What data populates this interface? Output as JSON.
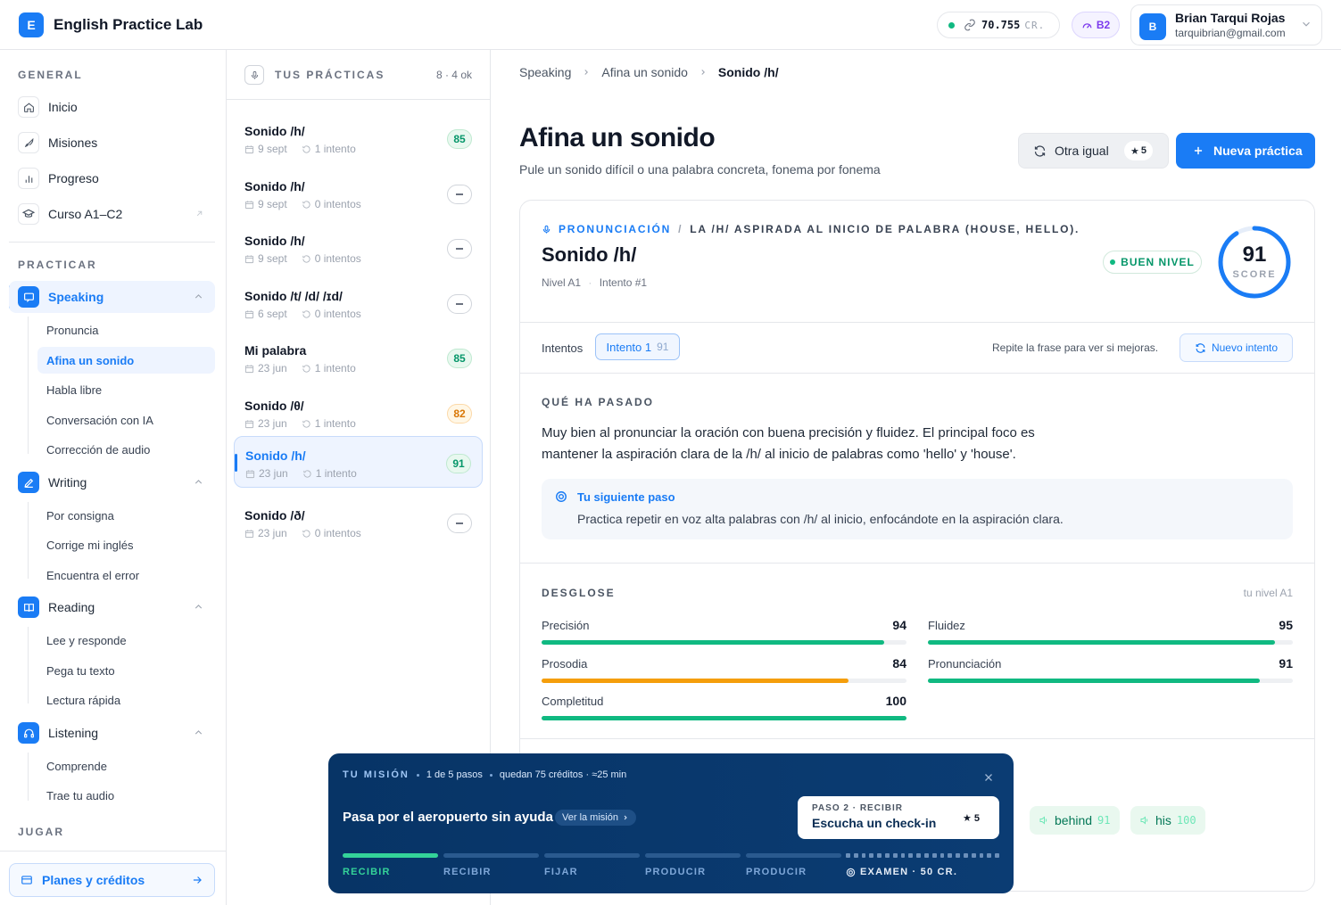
{
  "app": {
    "logo_letter": "E",
    "name": "English Practice Lab",
    "accent": "#1a7cf5"
  },
  "topbar": {
    "credits_value": "70.755",
    "credits_unit": "CR.",
    "level": "B2",
    "user": {
      "initial": "B",
      "name": "Brian Tarqui Rojas",
      "email": "tarquibrian@gmail.com"
    }
  },
  "sidebar": {
    "general_label": "GENERAL",
    "general": [
      {
        "label": "Inicio",
        "icon": "home-icon"
      },
      {
        "label": "Misiones",
        "icon": "rocket-icon"
      },
      {
        "label": "Progreso",
        "icon": "bar-chart-icon"
      },
      {
        "label": "Curso A1–C2",
        "icon": "graduation-cap-icon"
      }
    ],
    "practicar_label": "PRACTICAR",
    "groups": [
      {
        "label": "Speaking",
        "icon": "chat-icon",
        "items": [
          "Pronuncia",
          "Afina un sonido",
          "Habla libre",
          "Conversación con IA",
          "Corrección de audio"
        ]
      },
      {
        "label": "Writing",
        "icon": "pen-icon",
        "items": [
          "Por consigna",
          "Corrige mi inglés",
          "Encuentra el error"
        ]
      },
      {
        "label": "Reading",
        "icon": "book-icon",
        "items": [
          "Lee y responde",
          "Pega tu texto",
          "Lectura rápida"
        ]
      },
      {
        "label": "Listening",
        "icon": "headphones-icon",
        "items": [
          "Comprende",
          "Trae tu audio"
        ]
      }
    ],
    "jugar_label": "JUGAR",
    "plans_label": "Planes y créditos"
  },
  "practices": {
    "title": "TUS PRÁCTICAS",
    "count": "8 · 4 ok",
    "items": [
      {
        "title": "Sonido /h/",
        "date": "9 sept",
        "attempts": "1 intento",
        "score": "85"
      },
      {
        "title": "Sonido /h/",
        "date": "9 sept",
        "attempts": "0 intentos",
        "score": ""
      },
      {
        "title": "Sonido /h/",
        "date": "9 sept",
        "attempts": "0 intentos",
        "score": ""
      },
      {
        "title": "Sonido /t/ /d/ /ɪd/",
        "date": "6 sept",
        "attempts": "0 intentos",
        "score": ""
      },
      {
        "title": "Mi palabra",
        "date": "23 jun",
        "attempts": "1 intento",
        "score": "85"
      },
      {
        "title": "Sonido /θ/",
        "date": "23 jun",
        "attempts": "1 intento",
        "score": "82"
      },
      {
        "title": "Sonido /h/",
        "date": "23 jun",
        "attempts": "1 intento",
        "score": "91"
      },
      {
        "title": "Sonido /ð/",
        "date": "23 jun",
        "attempts": "0 intentos",
        "score": ""
      }
    ]
  },
  "main": {
    "breadcrumb": [
      "Speaking",
      "Afina un sonido",
      "Sonido /h/"
    ],
    "title": "Afina un sonido",
    "subtitle": "Pule un sonido difícil o una palabra concreta, fonema por fonema",
    "other_button": "Otra igual",
    "other_cost": "5",
    "new_button": "Nueva práctica",
    "card": {
      "kicker_category": "PRONUNCIACIÓN",
      "kicker_sep": "/",
      "kicker_desc": "LA /H/ ASPIRADA AL INICIO DE PALABRA (HOUSE, HELLO).",
      "title": "Sonido /h/",
      "level": "Nivel A1",
      "attempt": "Intento #1",
      "verdict": "BUEN NIVEL",
      "score": 91,
      "score_label": "SCORE",
      "attempts_label": "Intentos",
      "attempt_chip": "Intento 1",
      "attempt_chip_score": "91",
      "repeat_hint": "Repite la frase para ver si mejoras.",
      "new_attempt": "Nuevo intento",
      "what_label": "QUÉ HA PASADO",
      "what_text": "Muy bien al pronunciar la oración con buena precisión y fluidez. El principal foco es mantener la aspiración clara de la /h/ al inicio de palabras como 'hello' y 'house'.",
      "next_title": "Tu siguiente paso",
      "next_text": "Practica repetir en voz alta palabras con /h/ al inicio, enfocándote en la aspiración clara.",
      "breakdown_label": "DESGLOSE",
      "breakdown_hint": "tu nivel A1",
      "metrics": [
        {
          "label": "Precisión",
          "value": 94,
          "color": "#10b981"
        },
        {
          "label": "Fluidez",
          "value": 95,
          "color": "#10b981"
        },
        {
          "label": "Prosodia",
          "value": 84,
          "color": "#f59e0b"
        },
        {
          "label": "Pronunciación",
          "value": 91,
          "color": "#10b981"
        },
        {
          "label": "Completitud",
          "value": 100,
          "color": "#10b981"
        }
      ],
      "words": [
        {
          "word": "behind",
          "score": "91"
        },
        {
          "word": "his",
          "score": "100"
        }
      ]
    }
  },
  "mission": {
    "kicker": "TU MISIÓN",
    "steps_text": "1 de 5 pasos",
    "meta": "quedan 75 créditos · ≈25 min",
    "title": "Pasa por el aeropuerto sin ayuda",
    "link": "Ver la misión",
    "step_kicker": "PASO 2 · RECIBIR",
    "step_title": "Escucha un check-in",
    "step_cost": "5",
    "progress": [
      {
        "label": "RECIBIR",
        "done": true
      },
      {
        "label": "RECIBIR",
        "done": false
      },
      {
        "label": "FIJAR",
        "done": false
      },
      {
        "label": "PRODUCIR",
        "done": false
      },
      {
        "label": "PRODUCIR",
        "done": false
      }
    ],
    "exam": "EXAMEN · 50 CR."
  }
}
